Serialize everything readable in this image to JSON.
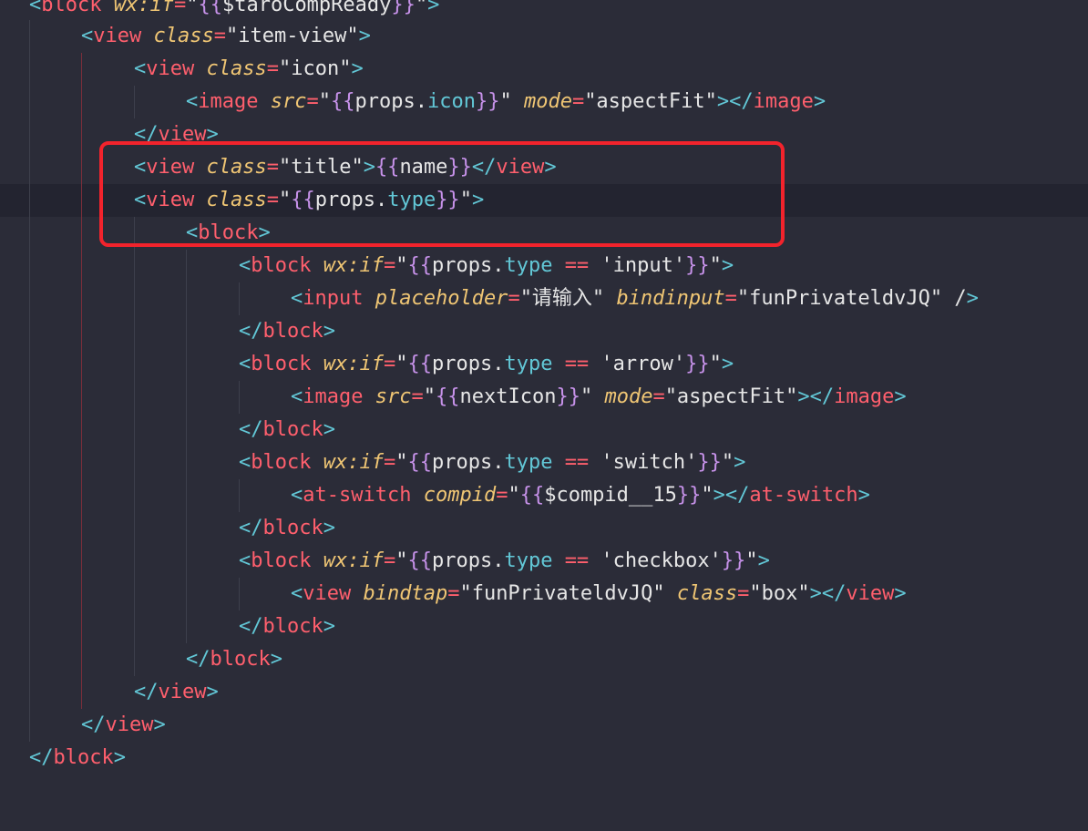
{
  "editor": {
    "lines": [
      "<block wx:if=\"{{$taroCompReady}}\">",
      "<view class=\"item-view\">",
      "<view class=\"icon\">",
      "<image src=\"{{props.icon}}\" mode=\"aspectFit\"></image>",
      "</view>",
      "<view class=\"title\">{{name}}</view>",
      "<view class=\"{{props.type}}\">",
      "<block>",
      "<block wx:if=\"{{props.type == 'input'}}\">",
      "<input placeholder=\"请输入\" bindinput=\"funPrivateldvJQ\" />",
      "</block>",
      "<block wx:if=\"{{props.type == 'arrow'}}\">",
      "<image src=\"{{nextIcon}}\" mode=\"aspectFit\"></image>",
      "</block>",
      "<block wx:if=\"{{props.type == 'switch'}}\">",
      "<at-switch compid=\"{{$compid__15}}\"></at-switch>",
      "</block>",
      "<block wx:if=\"{{props.type == 'checkbox'}}\">",
      "<view bindtap=\"funPrivateldvJQ\" class=\"box\"></view>",
      "</block>",
      "</block>",
      "</view>",
      "</view>",
      "</block>"
    ]
  },
  "colors": {
    "background": "#2b2c38",
    "current_line": "#232430",
    "tag": "#ff5f6d",
    "punctuation": "#62c7d6",
    "attribute": "#c3e88d",
    "highlight_box": "#f2232c"
  }
}
